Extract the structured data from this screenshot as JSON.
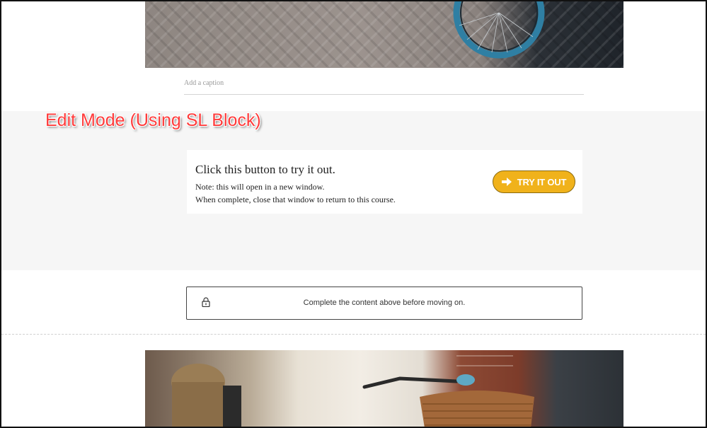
{
  "caption": {
    "placeholder": "Add a caption"
  },
  "annotation": {
    "text": "Edit Mode (Using SL Block)"
  },
  "storyline_block": {
    "heading": "Click this button to try it out.",
    "note_line1": "Note: this will open in a new window.",
    "note_line2": "When complete, close that window to return to this course.",
    "button_label": "TRY IT OUT",
    "button_icon": "arrow-right-icon"
  },
  "continue_block": {
    "icon": "lock-icon",
    "text": "Complete the content above before moving on."
  },
  "colors": {
    "annotation": "#ff3b3b",
    "button_fill": "#f0b21b",
    "block_background": "#f6f6f6"
  }
}
